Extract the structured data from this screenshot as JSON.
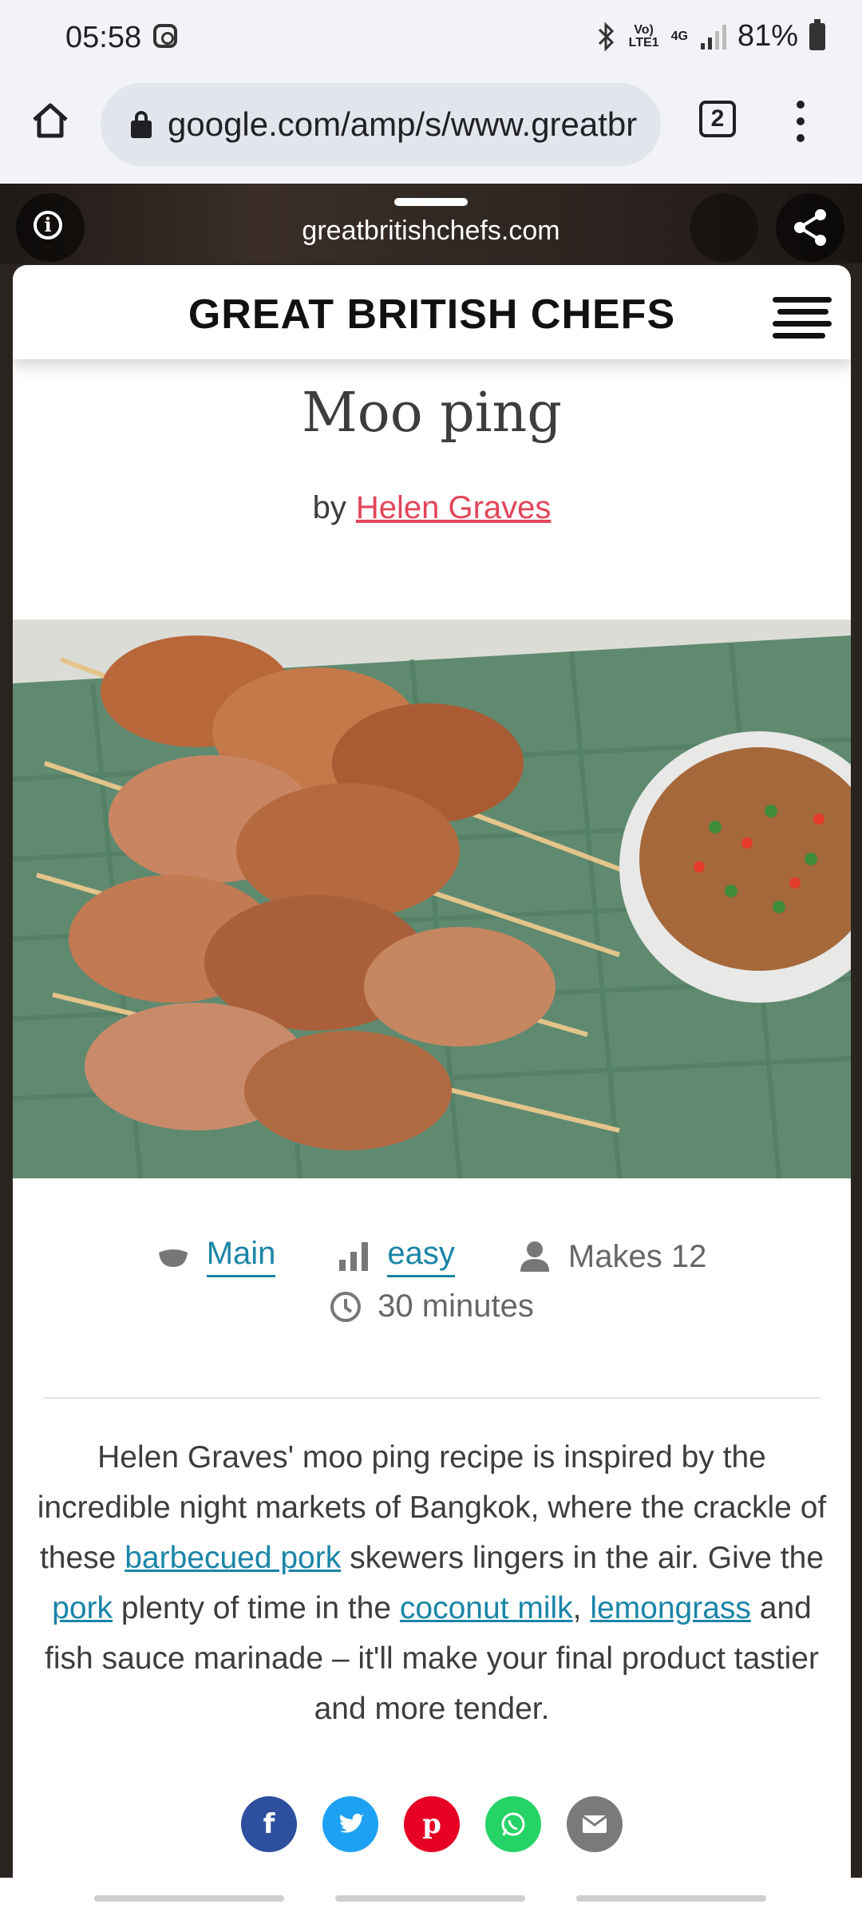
{
  "status": {
    "time": "05:58",
    "net_top": "Vo) LTE1",
    "net_4g": "4G",
    "battery": "81%"
  },
  "browser": {
    "url": "google.com/amp/s/www.greatbritishchefs.com",
    "tab_count": "2"
  },
  "amp": {
    "domain": "greatbritishchefs.com"
  },
  "site": {
    "logo": "GREAT BRITISH CHEFS"
  },
  "recipe": {
    "title": "Moo ping",
    "by": "by",
    "author": "Helen Graves",
    "course": "Main",
    "difficulty": "easy",
    "makes": "Makes 12",
    "time": "30 minutes"
  },
  "description": {
    "p1": "Helen Graves' moo ping recipe is inspired by the incredible night markets of Bangkok, where the crackle of these ",
    "link_barbecued_pork": "barbecued pork",
    "p2": " skewers lingers in the air. Give the ",
    "link_pork": "pork",
    "p3": " plenty of time in the ",
    "link_coconut_milk": "coconut milk",
    "p4": ", ",
    "link_lemongrass": "lemongrass",
    "p5": " and fish sauce marinade – it'll make your final product tastier and more tender."
  },
  "share": [
    {
      "name": "facebook",
      "glyph": "f",
      "color": "#2d4f9e"
    },
    {
      "name": "twitter",
      "glyph": "t",
      "color": "#1da1f2"
    },
    {
      "name": "pinterest",
      "glyph": "p",
      "color": "#e60023"
    },
    {
      "name": "whatsapp",
      "glyph": "w",
      "color": "#25d366"
    },
    {
      "name": "email",
      "glyph": "✉",
      "color": "#7a7a7a"
    }
  ]
}
